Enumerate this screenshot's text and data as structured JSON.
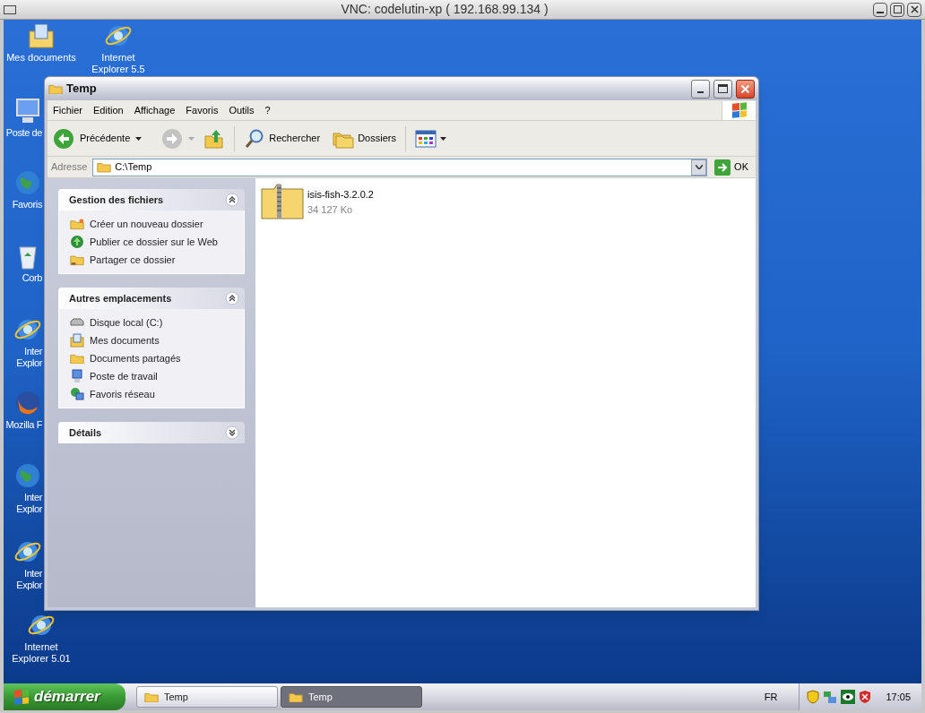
{
  "vnc": {
    "title": "VNC: codelutin-xp ( 192.168.99.134 )"
  },
  "desktop_icons": [
    {
      "kind": "documents",
      "lines": [
        "Mes documents"
      ]
    },
    {
      "kind": "ie",
      "lines": [
        "Internet",
        "Explorer 5.5"
      ]
    },
    {
      "kind": "computer",
      "lines": [
        "Poste de"
      ]
    },
    {
      "kind": "globe",
      "lines": [
        "Favoris"
      ]
    },
    {
      "kind": "recycle",
      "lines": [
        "Corb"
      ]
    },
    {
      "kind": "ie",
      "lines": [
        "Inter",
        "Explor"
      ]
    },
    {
      "kind": "firefox",
      "lines": [
        "Mozilla F"
      ]
    },
    {
      "kind": "globe",
      "lines": [
        "Inter",
        "Explor"
      ]
    },
    {
      "kind": "ie",
      "lines": [
        "Inter",
        "Explor"
      ]
    },
    {
      "kind": "ie",
      "lines": [
        "Internet",
        "Explorer 5.01"
      ]
    }
  ],
  "window": {
    "title": "Temp",
    "menu": [
      "Fichier",
      "Edition",
      "Affichage",
      "Favoris",
      "Outils",
      "?"
    ],
    "toolbar": {
      "back": "Précédente",
      "search": "Rechercher",
      "folders": "Dossiers"
    },
    "address": {
      "label": "Adresse",
      "value": "C:\\Temp",
      "go": "OK"
    },
    "task_panels": [
      {
        "title": "Gestion des fichiers",
        "expanded": true,
        "items": [
          {
            "label": "Créer un nouveau dossier"
          },
          {
            "label": "Publier ce dossier sur le Web"
          },
          {
            "label": "Partager ce dossier"
          }
        ]
      },
      {
        "title": "Autres emplacements",
        "expanded": true,
        "items": [
          {
            "label": "Disque local (C:)"
          },
          {
            "label": "Mes documents"
          },
          {
            "label": "Documents partagés"
          },
          {
            "label": "Poste de travail"
          },
          {
            "label": "Favoris réseau"
          }
        ]
      },
      {
        "title": "Détails",
        "expanded": false
      }
    ],
    "files": [
      {
        "name": "isis-fish-3.2.0.2",
        "size": "34 127 Ko"
      }
    ]
  },
  "taskbar": {
    "start": "démarrer",
    "buttons": [
      {
        "label": "Temp",
        "selected": false
      },
      {
        "label": "Temp",
        "selected": true
      }
    ],
    "language": "FR",
    "clock": "17:05"
  }
}
